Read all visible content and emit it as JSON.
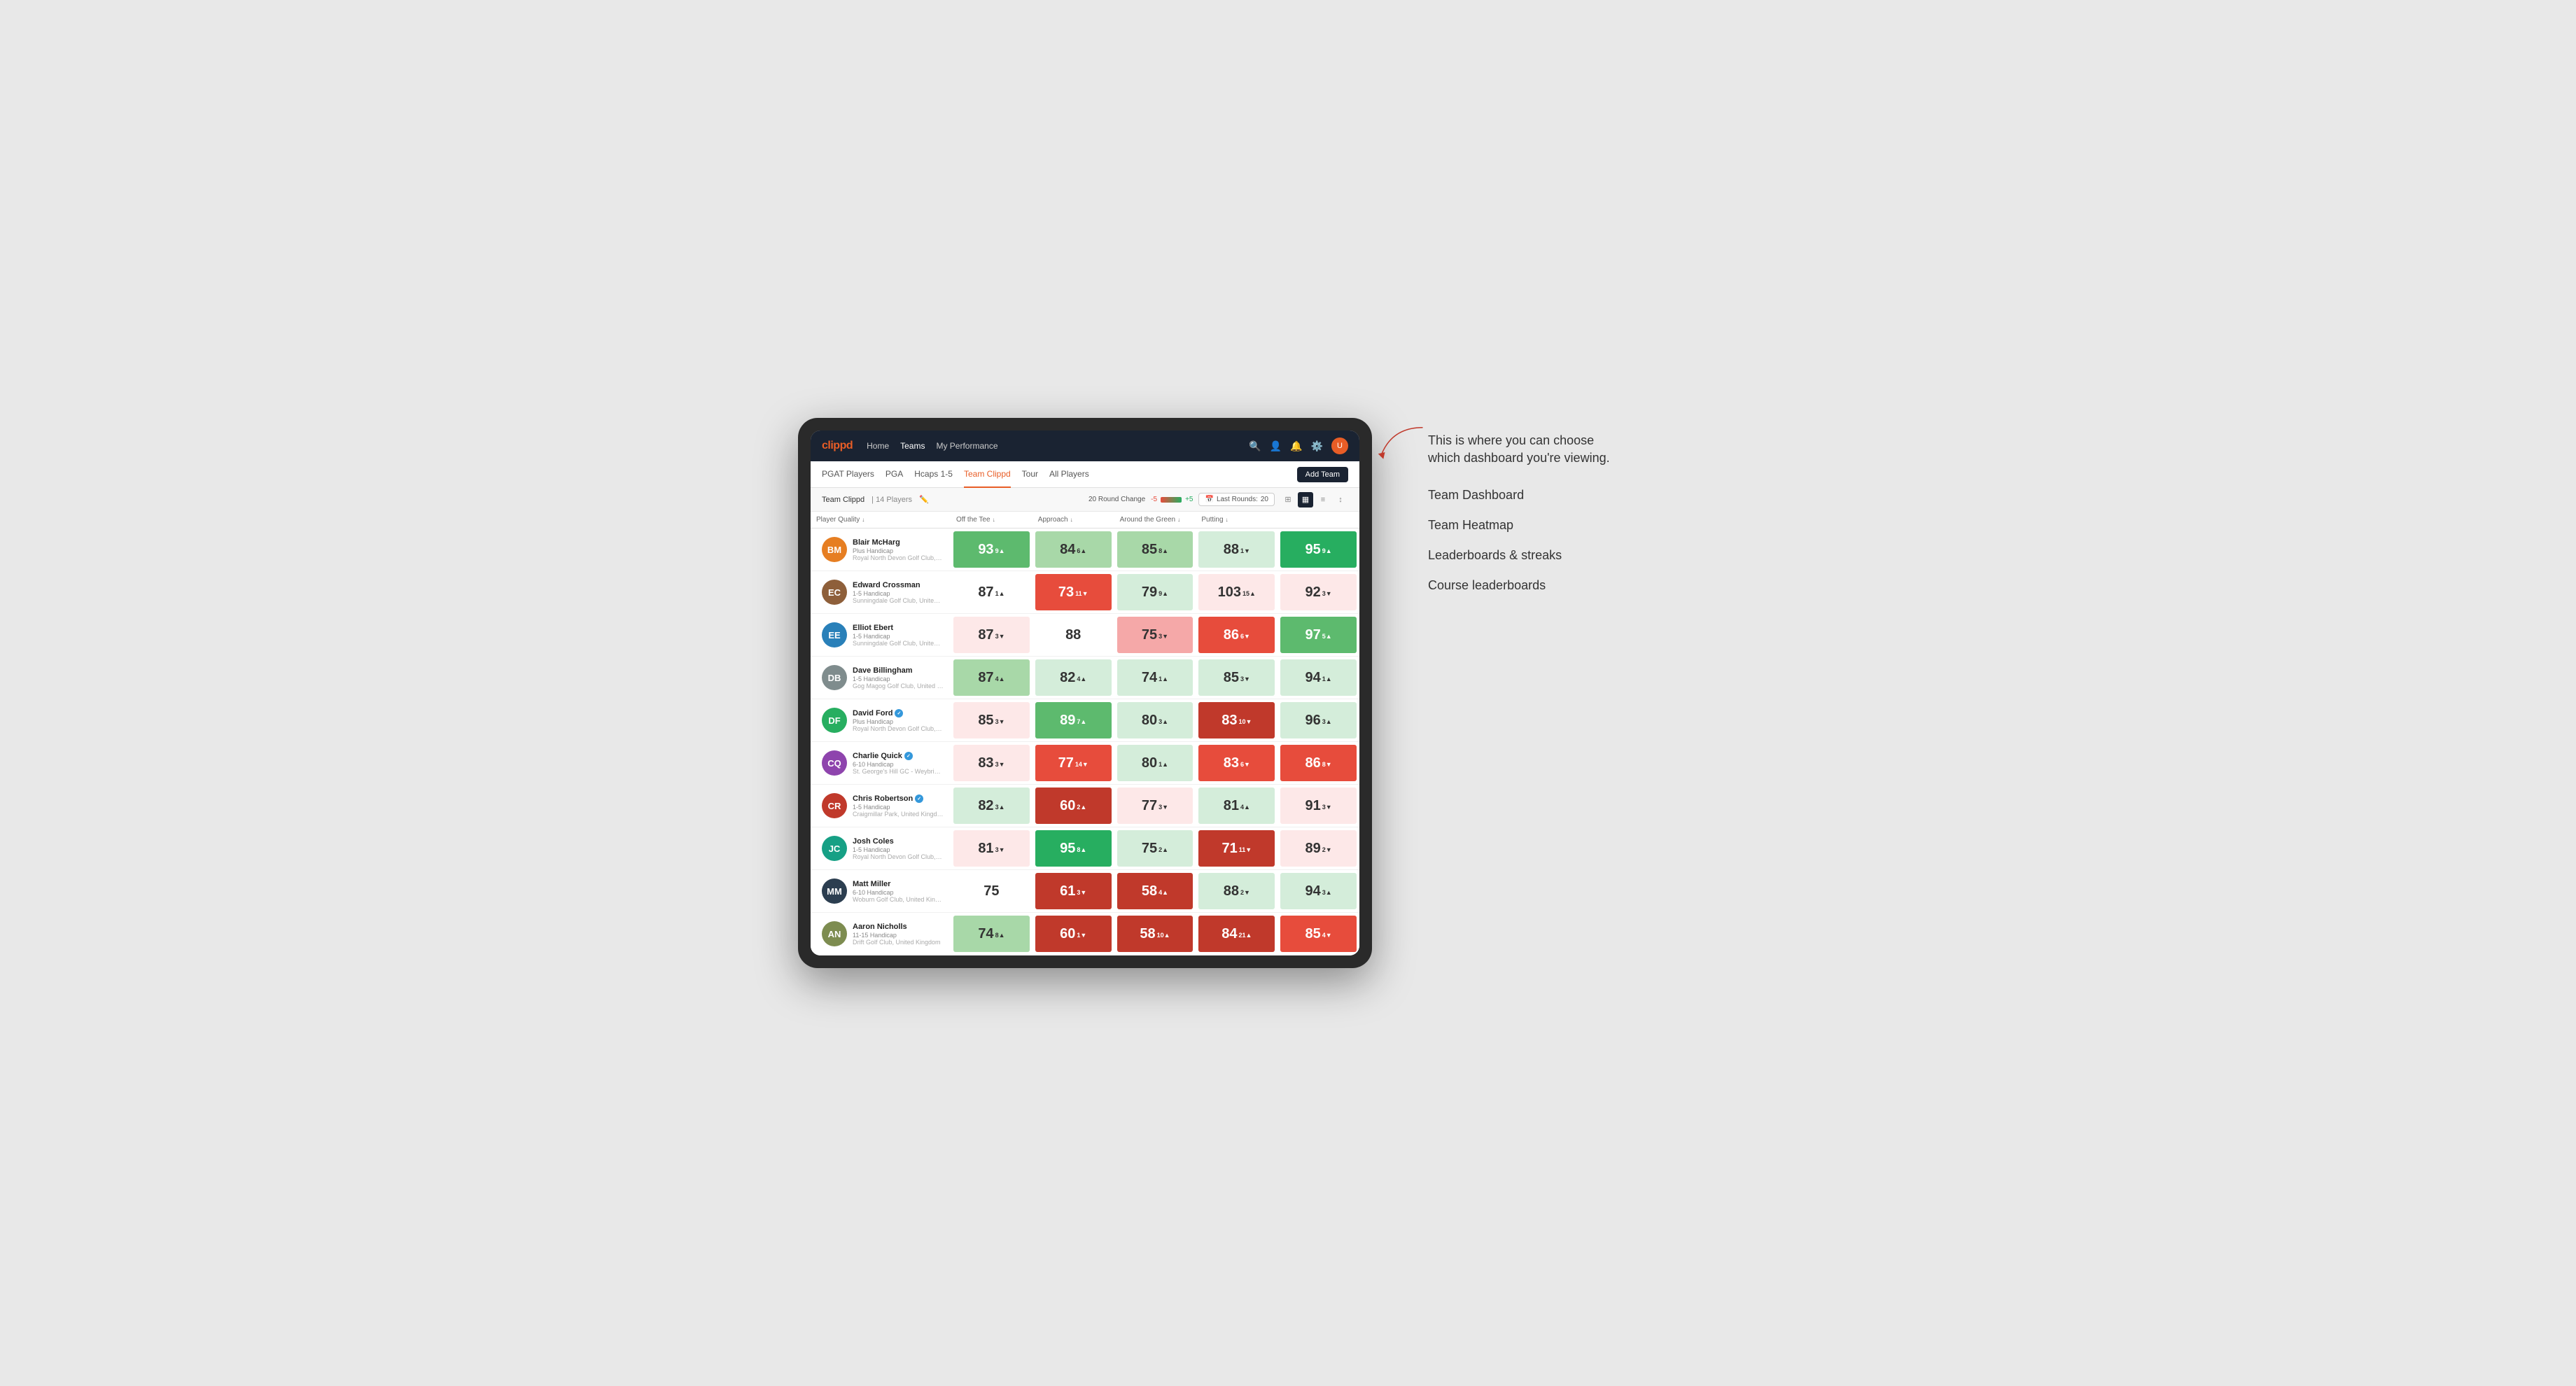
{
  "annotation": {
    "intro": "This is where you can choose which dashboard you're viewing.",
    "items": [
      "Team Dashboard",
      "Team Heatmap",
      "Leaderboards & streaks",
      "Course leaderboards"
    ]
  },
  "nav": {
    "logo": "clippd",
    "links": [
      "Home",
      "Teams",
      "My Performance"
    ],
    "active_link": "Teams"
  },
  "sub_nav": {
    "links": [
      "PGAT Players",
      "PGA",
      "Hcaps 1-5",
      "Team Clippd",
      "Tour",
      "All Players"
    ],
    "active_link": "Team Clippd",
    "add_team_label": "Add Team"
  },
  "team_header": {
    "name": "Team Clippd",
    "separator": "|",
    "player_count": "14 Players",
    "round_change_label": "20 Round Change",
    "round_change_neg": "-5",
    "round_change_pos": "+5",
    "last_rounds_label": "Last Rounds:",
    "last_rounds_value": "20"
  },
  "col_headers": [
    {
      "label": "Player Quality",
      "arrow": "↓"
    },
    {
      "label": "Off the Tee",
      "arrow": "↓"
    },
    {
      "label": "Approach",
      "arrow": "↓"
    },
    {
      "label": "Around the Green",
      "arrow": "↓"
    },
    {
      "label": "Putting",
      "arrow": "↓"
    }
  ],
  "players": [
    {
      "name": "Blair McHarg",
      "handicap": "Plus Handicap",
      "club": "Royal North Devon Golf Club, United Kingdom",
      "avatar_initials": "BM",
      "avatar_class": "av-orange",
      "verified": false,
      "scores": [
        {
          "value": "93",
          "change": "9",
          "dir": "▲",
          "bg": "bg-green-mid",
          "text": "text-white"
        },
        {
          "value": "84",
          "change": "6",
          "dir": "▲",
          "bg": "bg-green-light",
          "text": "text-dark"
        },
        {
          "value": "85",
          "change": "8",
          "dir": "▲",
          "bg": "bg-green-light",
          "text": "text-dark"
        },
        {
          "value": "88",
          "change": "1",
          "dir": "▼",
          "bg": "bg-green-pale",
          "text": "text-dark"
        },
        {
          "value": "95",
          "change": "9",
          "dir": "▲",
          "bg": "bg-green-strong",
          "text": "text-white"
        }
      ]
    },
    {
      "name": "Edward Crossman",
      "handicap": "1-5 Handicap",
      "club": "Sunningdale Golf Club, United Kingdom",
      "avatar_initials": "EC",
      "avatar_class": "av-brown",
      "verified": false,
      "scores": [
        {
          "value": "87",
          "change": "1",
          "dir": "▲",
          "bg": "bg-white",
          "text": "text-dark"
        },
        {
          "value": "73",
          "change": "11",
          "dir": "▼",
          "bg": "bg-red-mid",
          "text": "text-white"
        },
        {
          "value": "79",
          "change": "9",
          "dir": "▲",
          "bg": "bg-green-pale",
          "text": "text-dark"
        },
        {
          "value": "103",
          "change": "15",
          "dir": "▲",
          "bg": "bg-red-pale",
          "text": "text-dark"
        },
        {
          "value": "92",
          "change": "3",
          "dir": "▼",
          "bg": "bg-red-pale",
          "text": "text-dark"
        }
      ]
    },
    {
      "name": "Elliot Ebert",
      "handicap": "1-5 Handicap",
      "club": "Sunningdale Golf Club, United Kingdom",
      "avatar_initials": "EE",
      "avatar_class": "av-blue",
      "verified": false,
      "scores": [
        {
          "value": "87",
          "change": "3",
          "dir": "▼",
          "bg": "bg-red-pale",
          "text": "text-dark"
        },
        {
          "value": "88",
          "change": "",
          "dir": "",
          "bg": "bg-white",
          "text": "text-dark"
        },
        {
          "value": "75",
          "change": "3",
          "dir": "▼",
          "bg": "bg-red-light",
          "text": "text-dark"
        },
        {
          "value": "86",
          "change": "6",
          "dir": "▼",
          "bg": "bg-red-mid",
          "text": "text-white"
        },
        {
          "value": "97",
          "change": "5",
          "dir": "▲",
          "bg": "bg-green-mid",
          "text": "text-white"
        }
      ]
    },
    {
      "name": "Dave Billingham",
      "handicap": "1-5 Handicap",
      "club": "Gog Magog Golf Club, United Kingdom",
      "avatar_initials": "DB",
      "avatar_class": "av-gray",
      "verified": false,
      "scores": [
        {
          "value": "87",
          "change": "4",
          "dir": "▲",
          "bg": "bg-green-light",
          "text": "text-dark"
        },
        {
          "value": "82",
          "change": "4",
          "dir": "▲",
          "bg": "bg-green-pale",
          "text": "text-dark"
        },
        {
          "value": "74",
          "change": "1",
          "dir": "▲",
          "bg": "bg-green-pale",
          "text": "text-dark"
        },
        {
          "value": "85",
          "change": "3",
          "dir": "▼",
          "bg": "bg-green-pale",
          "text": "text-dark"
        },
        {
          "value": "94",
          "change": "1",
          "dir": "▲",
          "bg": "bg-green-pale",
          "text": "text-dark"
        }
      ]
    },
    {
      "name": "David Ford",
      "handicap": "Plus Handicap",
      "club": "Royal North Devon Golf Club, United Kingdom",
      "avatar_initials": "DF",
      "avatar_class": "av-green",
      "verified": true,
      "scores": [
        {
          "value": "85",
          "change": "3",
          "dir": "▼",
          "bg": "bg-red-pale",
          "text": "text-dark"
        },
        {
          "value": "89",
          "change": "7",
          "dir": "▲",
          "bg": "bg-green-mid",
          "text": "text-white"
        },
        {
          "value": "80",
          "change": "3",
          "dir": "▲",
          "bg": "bg-green-pale",
          "text": "text-dark"
        },
        {
          "value": "83",
          "change": "10",
          "dir": "▼",
          "bg": "bg-red-strong",
          "text": "text-white"
        },
        {
          "value": "96",
          "change": "3",
          "dir": "▲",
          "bg": "bg-green-pale",
          "text": "text-dark"
        }
      ]
    },
    {
      "name": "Charlie Quick",
      "handicap": "6-10 Handicap",
      "club": "St. George's Hill GC - Weybridge - Surrey, Uni...",
      "avatar_initials": "CQ",
      "avatar_class": "av-purple",
      "verified": true,
      "scores": [
        {
          "value": "83",
          "change": "3",
          "dir": "▼",
          "bg": "bg-red-pale",
          "text": "text-dark"
        },
        {
          "value": "77",
          "change": "14",
          "dir": "▼",
          "bg": "bg-red-mid",
          "text": "text-white"
        },
        {
          "value": "80",
          "change": "1",
          "dir": "▲",
          "bg": "bg-green-pale",
          "text": "text-dark"
        },
        {
          "value": "83",
          "change": "6",
          "dir": "▼",
          "bg": "bg-red-mid",
          "text": "text-white"
        },
        {
          "value": "86",
          "change": "8",
          "dir": "▼",
          "bg": "bg-red-mid",
          "text": "text-white"
        }
      ]
    },
    {
      "name": "Chris Robertson",
      "handicap": "1-5 Handicap",
      "club": "Craigmillar Park, United Kingdom",
      "avatar_initials": "CR",
      "avatar_class": "av-red",
      "verified": true,
      "scores": [
        {
          "value": "82",
          "change": "3",
          "dir": "▲",
          "bg": "bg-green-pale",
          "text": "text-dark"
        },
        {
          "value": "60",
          "change": "2",
          "dir": "▲",
          "bg": "bg-red-strong",
          "text": "text-white"
        },
        {
          "value": "77",
          "change": "3",
          "dir": "▼",
          "bg": "bg-red-pale",
          "text": "text-dark"
        },
        {
          "value": "81",
          "change": "4",
          "dir": "▲",
          "bg": "bg-green-pale",
          "text": "text-dark"
        },
        {
          "value": "91",
          "change": "3",
          "dir": "▼",
          "bg": "bg-red-pale",
          "text": "text-dark"
        }
      ]
    },
    {
      "name": "Josh Coles",
      "handicap": "1-5 Handicap",
      "club": "Royal North Devon Golf Club, United Kingdom",
      "avatar_initials": "JC",
      "avatar_class": "av-teal",
      "verified": false,
      "scores": [
        {
          "value": "81",
          "change": "3",
          "dir": "▼",
          "bg": "bg-red-pale",
          "text": "text-dark"
        },
        {
          "value": "95",
          "change": "8",
          "dir": "▲",
          "bg": "bg-green-strong",
          "text": "text-white"
        },
        {
          "value": "75",
          "change": "2",
          "dir": "▲",
          "bg": "bg-green-pale",
          "text": "text-dark"
        },
        {
          "value": "71",
          "change": "11",
          "dir": "▼",
          "bg": "bg-red-strong",
          "text": "text-white"
        },
        {
          "value": "89",
          "change": "2",
          "dir": "▼",
          "bg": "bg-red-pale",
          "text": "text-dark"
        }
      ]
    },
    {
      "name": "Matt Miller",
      "handicap": "6-10 Handicap",
      "club": "Woburn Golf Club, United Kingdom",
      "avatar_initials": "MM",
      "avatar_class": "av-dark",
      "verified": false,
      "scores": [
        {
          "value": "75",
          "change": "",
          "dir": "",
          "bg": "bg-white",
          "text": "text-dark"
        },
        {
          "value": "61",
          "change": "3",
          "dir": "▼",
          "bg": "bg-red-strong",
          "text": "text-white"
        },
        {
          "value": "58",
          "change": "4",
          "dir": "▲",
          "bg": "bg-red-strong",
          "text": "text-white"
        },
        {
          "value": "88",
          "change": "2",
          "dir": "▼",
          "bg": "bg-green-pale",
          "text": "text-dark"
        },
        {
          "value": "94",
          "change": "3",
          "dir": "▲",
          "bg": "bg-green-pale",
          "text": "text-dark"
        }
      ]
    },
    {
      "name": "Aaron Nicholls",
      "handicap": "11-15 Handicap",
      "club": "Drift Golf Club, United Kingdom",
      "avatar_initials": "AN",
      "avatar_class": "av-olive",
      "verified": false,
      "scores": [
        {
          "value": "74",
          "change": "8",
          "dir": "▲",
          "bg": "bg-green-light",
          "text": "text-dark"
        },
        {
          "value": "60",
          "change": "1",
          "dir": "▼",
          "bg": "bg-red-strong",
          "text": "text-white"
        },
        {
          "value": "58",
          "change": "10",
          "dir": "▲",
          "bg": "bg-red-strong",
          "text": "text-white"
        },
        {
          "value": "84",
          "change": "21",
          "dir": "▲",
          "bg": "bg-red-strong",
          "text": "text-white"
        },
        {
          "value": "85",
          "change": "4",
          "dir": "▼",
          "bg": "bg-red-mid",
          "text": "text-white"
        }
      ]
    }
  ]
}
